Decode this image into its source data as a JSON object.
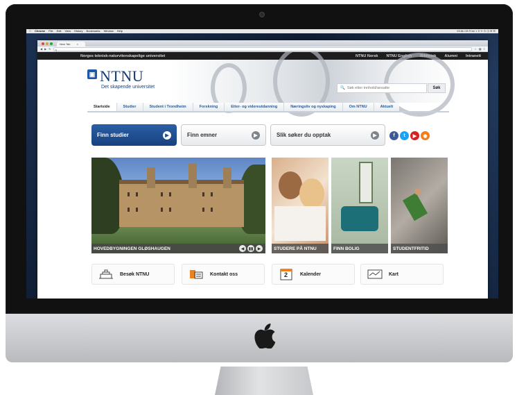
{
  "macos_menubar": {
    "items": [
      "Chrome",
      "File",
      "Edit",
      "View",
      "History",
      "Bookmarks",
      "Window",
      "Help"
    ],
    "status": "53.8k CB Free ◐ 0 ᯤ ⊙ ◷ ⊕ ☰"
  },
  "browser": {
    "tab_title": "New Tab",
    "url": "q"
  },
  "ntnu": {
    "topbar": {
      "university_name": "Norges teknisk-naturvitenskapelige universitet",
      "links": [
        "NTNU Norsk",
        "NTNU English",
        "Bibliotek",
        "Alumni",
        "Intranett"
      ]
    },
    "logo": {
      "wordmark": "NTNU",
      "tagline": "Det skapende universitet"
    },
    "search": {
      "placeholder": "Søk etter innhold/ansatte",
      "button": "Søk"
    },
    "nav": [
      "Startside",
      "Studier",
      "Student i Trondheim",
      "Forskning",
      "Etter- og videreutdanning",
      "Næringsliv og nyskaping",
      "Om NTNU",
      "Aktuelt"
    ],
    "ctas": [
      {
        "label": "Finn studier"
      },
      {
        "label": "Finn emner"
      },
      {
        "label": "Slik søker du opptak"
      }
    ],
    "social_icons": [
      "facebook-icon",
      "twitter-icon",
      "youtube-icon",
      "rss-icon"
    ],
    "hero": {
      "caption": "HOVEDBYGNINGEN GLØSHAUGEN",
      "controls": [
        "◀",
        "▮▮",
        "▶"
      ]
    },
    "tiles": [
      {
        "caption": "STUDERE PÅ NTNU"
      },
      {
        "caption": "FINN BOLIG"
      },
      {
        "caption": "STUDENTFRITID"
      }
    ],
    "quick_links": [
      {
        "label": "Besøk NTNU",
        "icon": "building-icon"
      },
      {
        "label": "Kontakt oss",
        "icon": "contact-card-icon"
      },
      {
        "label": "Kalender",
        "icon": "calendar-icon",
        "icon_text": "2"
      },
      {
        "label": "Kart",
        "icon": "map-icon"
      }
    ]
  },
  "colors": {
    "ntnu_blue": "#17417f",
    "nav_text": "#2c5a91",
    "facebook": "#3b5998",
    "twitter": "#1da1f2",
    "youtube": "#d8201e",
    "rss": "#ef7f1a"
  }
}
